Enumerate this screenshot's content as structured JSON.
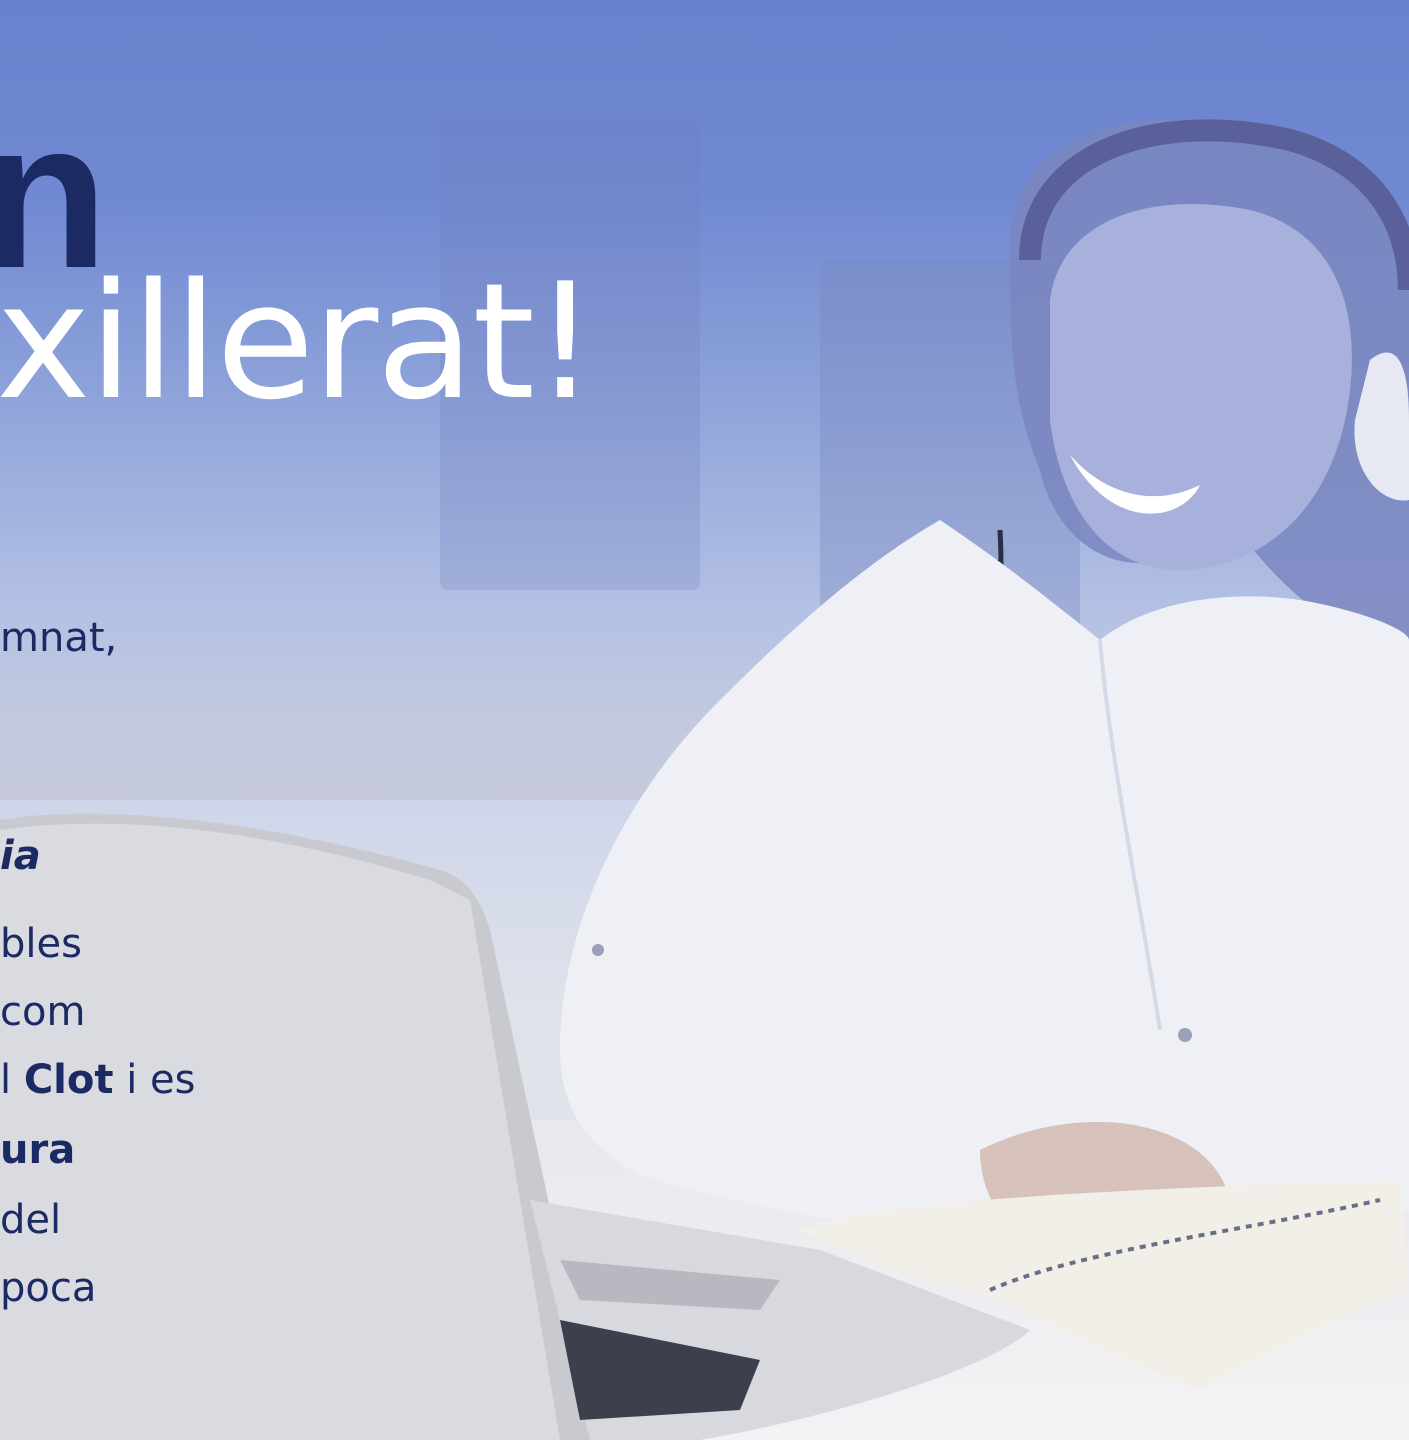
{
  "title": {
    "line1": "n",
    "line2": "xillerat!"
  },
  "body": {
    "line_1": "mnat,",
    "line_2": "ia",
    "line_3": "bles",
    "line_4": "com",
    "line_5_pre": "l ",
    "line_5_bold": "Clot",
    "line_5_post": " i es",
    "line_6": "ura",
    "line_7": "del",
    "line_8": " poca"
  },
  "colors": {
    "title_dark": "#1b2a63",
    "title_light": "#ffffff",
    "background_blue": "#6b83cf"
  },
  "image": {
    "subject": "woman-with-headphones-at-laptop"
  }
}
